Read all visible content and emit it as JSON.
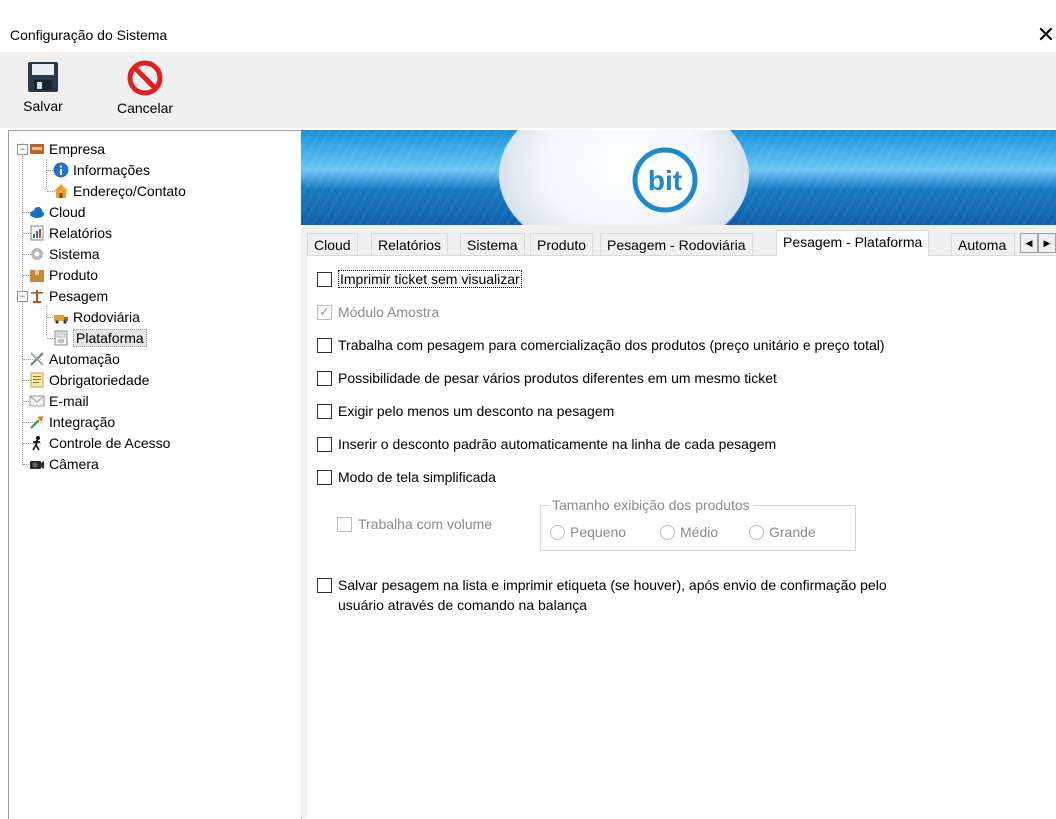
{
  "window": {
    "title": "Configuração do Sistema",
    "close_glyph": "✕"
  },
  "toolbar": {
    "save_label": "Salvar",
    "cancel_label": "Cancelar"
  },
  "tree": {
    "empresa": "Empresa",
    "informacoes": "Informações",
    "endereco": "Endereço/Contato",
    "cloud": "Cloud",
    "relatorios": "Relatórios",
    "sistema": "Sistema",
    "produto": "Produto",
    "pesagem": "Pesagem",
    "rodoviaria": "Rodoviária",
    "plataforma": "Plataforma",
    "automacao": "Automação",
    "obrigatoriedade": "Obrigatoriedade",
    "email": "E-mail",
    "integracao": "Integração",
    "controle": "Controle de Acesso",
    "camera": "Câmera"
  },
  "banner": {
    "logo_text": "bit"
  },
  "tabs": [
    "Cloud",
    "Relatórios",
    "Sistema",
    "Produto",
    "Pesagem - Rodoviária",
    "Pesagem - Plataforma",
    "Automa"
  ],
  "active_tab": "Pesagem - Plataforma",
  "options": {
    "imprimir_ticket": "Imprimir ticket sem visualizar",
    "modulo_amostra": "Módulo Amostra",
    "comercializacao": "Trabalha com pesagem para comercialização dos produtos (preço unitário e preço total)",
    "varios_produtos": "Possibilidade de pesar vários produtos diferentes em um mesmo ticket",
    "exigir_desconto": "Exigir pelo menos um desconto na pesagem",
    "inserir_desconto": "Inserir o desconto padrão automaticamente na linha de cada pesagem",
    "modo_simplificado": "Modo de tela simplificada",
    "trabalha_volume": "Trabalha com volume",
    "salvar_line1": "Salvar pesagem na lista e imprimir etiqueta (se houver), após envio de confirmação pelo",
    "salvar_line2": "usuário através de comando na balança"
  },
  "tamanho_group": {
    "legend": "Tamanho exibição dos produtos",
    "pequeno": "Pequeno",
    "medio": "Médio",
    "grande": "Grande"
  },
  "colors": {
    "banner_blue": "#1a8ed8",
    "cancel_red": "#e02020",
    "info_blue": "#1e73d2"
  }
}
